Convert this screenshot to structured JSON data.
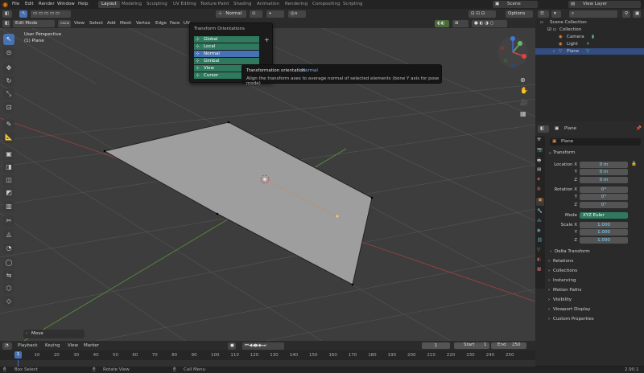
{
  "topbar": {
    "menus": [
      "File",
      "Edit",
      "Render",
      "Window",
      "Help"
    ],
    "workspaces": [
      "Layout",
      "Modeling",
      "Sculpting",
      "UV Editing",
      "Texture Paint",
      "Shading",
      "Animation",
      "Rendering",
      "Compositing",
      "Scripting"
    ],
    "active_workspace": "Layout",
    "scene": "Scene",
    "view_layer": "View Layer"
  },
  "header": {
    "mode": "Edit Mode",
    "menus": [
      "View",
      "Select",
      "Add",
      "Mesh",
      "Vertex",
      "Edge",
      "Face",
      "UV"
    ],
    "orientation": "Normal",
    "options": "Options"
  },
  "viewport": {
    "perspective": "User Perspective",
    "object": "(1) Plane"
  },
  "dropdown": {
    "title": "Transform Orientations",
    "items": [
      "Global",
      "Local",
      "Normal",
      "Gimbal",
      "View",
      "Cursor"
    ],
    "selected": "Normal"
  },
  "tooltip": {
    "title": "Transformation orientation:",
    "value": "Normal",
    "desc": "Align the transform axes to average normal of selected elements (bone Y axis for pose mode)"
  },
  "outliner": {
    "root": "Scene Collection",
    "items": [
      "Collection",
      "Camera",
      "Light",
      "Plane"
    ]
  },
  "properties": {
    "object_name": "Plane",
    "object_field": "Plane",
    "transform_label": "Transform",
    "location_label": "Location X",
    "rotation_label": "Rotation X",
    "scale_label": "Scale X",
    "y": "Y",
    "z": "Z",
    "loc": [
      "0 m",
      "0 m",
      "0 m"
    ],
    "rot": [
      "0°",
      "0°",
      "0°"
    ],
    "scale": [
      "1.000",
      "1.000",
      "1.000"
    ],
    "mode_label": "Mode",
    "mode_value": "XYZ Euler",
    "delta": "Delta Transform",
    "sections": [
      "Relations",
      "Collections",
      "Instancing",
      "Motion Paths",
      "Visibility",
      "Viewport Display",
      "Custom Properties"
    ]
  },
  "last_op": "Move",
  "timeline": {
    "menus": [
      "Playback",
      "Keying",
      "View",
      "Marker"
    ],
    "current": "1",
    "start_label": "Start",
    "start": "1",
    "end_label": "End",
    "end": "250",
    "ticks": [
      "0",
      "10",
      "20",
      "30",
      "40",
      "50",
      "60",
      "70",
      "80",
      "90",
      "100",
      "110",
      "120",
      "130",
      "140",
      "150",
      "160",
      "170",
      "180",
      "190",
      "200",
      "210",
      "220",
      "230",
      "240",
      "250"
    ],
    "frame_badge": "1"
  },
  "status": {
    "select": "Box Select",
    "rotate": "Rotate View",
    "call": "Call Menu",
    "version": "2.90.1"
  },
  "colors": {
    "accent": "#4772b3",
    "menu_green": "#2f7a5f",
    "field_blue": "#7fd6ff"
  }
}
